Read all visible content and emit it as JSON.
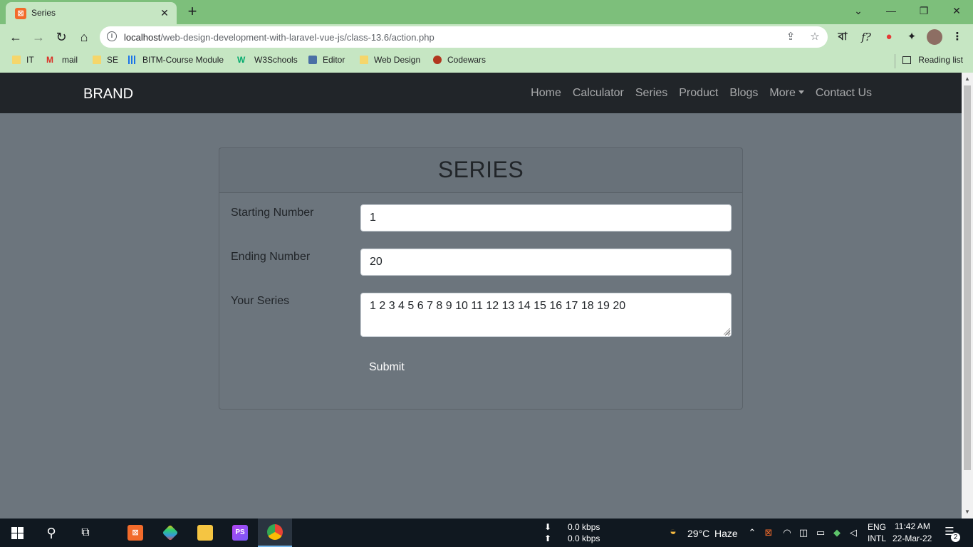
{
  "browser": {
    "tab_title": "Series",
    "tab_favicon": "xampp-icon",
    "url_host": "localhost",
    "url_path": "/web-design-development-with-laravel-vue-js/class-13.6/action.php",
    "bookmarks": [
      {
        "label": "IT",
        "icon": "folder-icon"
      },
      {
        "label": "mail",
        "icon": "gmail-icon"
      },
      {
        "label": "SE",
        "icon": "folder-icon"
      },
      {
        "label": "BITM-Course Module",
        "icon": "bitm-icon"
      },
      {
        "label": "W3Schools",
        "icon": "w3schools-icon"
      },
      {
        "label": "Editor",
        "icon": "editor-icon"
      },
      {
        "label": "Web Design",
        "icon": "folder-icon"
      },
      {
        "label": "Codewars",
        "icon": "codewars-icon"
      }
    ],
    "reading_list": "Reading list",
    "ext_bangla": "বা",
    "ext_formula": "f?"
  },
  "site": {
    "brand": "BRAND",
    "nav": [
      "Home",
      "Calculator",
      "Series",
      "Product",
      "Blogs",
      "More",
      "Contact Us"
    ]
  },
  "form": {
    "title": "SERIES",
    "starting_label": "Starting Number",
    "starting_value": "1",
    "ending_label": "Ending Number",
    "ending_value": "20",
    "series_label": "Your Series",
    "series_value": "1 2 3 4 5 6 7 8 9 10 11 12 13 14 15 16 17 18 19 20",
    "submit_label": "Submit"
  },
  "taskbar": {
    "net_down": "0.0 kbps",
    "net_up": "0.0 kbps",
    "weather_temp": "29°C",
    "weather_desc": "Haze",
    "lang_top": "ENG",
    "lang_bottom": "INTL",
    "time": "11:42 AM",
    "date": "22-Mar-22",
    "notification_count": "2"
  },
  "colors": {
    "tab_strip": "#7dbf7b",
    "toolbar": "#c6e6c3",
    "navbar": "#212529",
    "page_bg": "#6c757d",
    "taskbar": "#101820"
  }
}
